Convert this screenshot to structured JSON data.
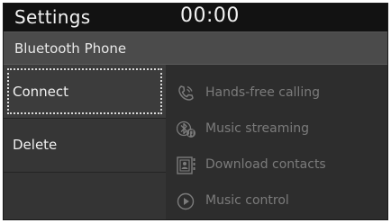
{
  "header": {
    "title": "Settings",
    "clock": "00:00"
  },
  "subheader": {
    "title": "Bluetooth Phone"
  },
  "menu": {
    "items": [
      {
        "label": "Connect",
        "selected": true
      },
      {
        "label": "Delete",
        "selected": false
      }
    ]
  },
  "features": [
    {
      "label": "Hands-free calling",
      "icon": "phone-icon"
    },
    {
      "label": "Music streaming",
      "icon": "bluetooth-music-icon"
    },
    {
      "label": "Download contacts",
      "icon": "contacts-icon"
    },
    {
      "label": "Music control",
      "icon": "play-icon"
    }
  ],
  "colors": {
    "background": "#3a3a3a",
    "header": "#121212",
    "text": "#f0f0f0",
    "disabled_text": "#7b7b7b"
  }
}
